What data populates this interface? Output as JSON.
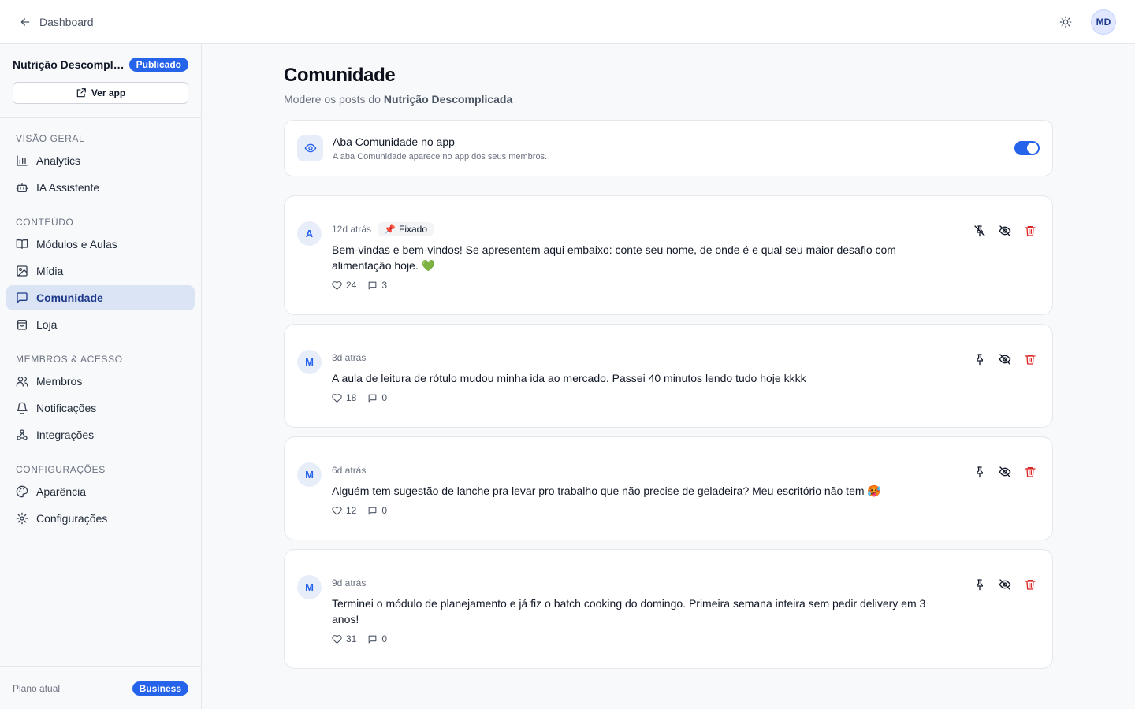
{
  "topbar": {
    "back_label": "Dashboard",
    "user_initials": "MD"
  },
  "sidebar": {
    "app_name": "Nutrição Descomplicada",
    "status_badge": "Publicado",
    "view_app_label": "Ver app",
    "sections": {
      "overview": "VISÃO GERAL",
      "content": "CONTEÚDO",
      "members": "MEMBROS & ACESSO",
      "settings": "CONFIGURAÇÕES"
    },
    "items": {
      "analytics": "Analytics",
      "assistant": "IA Assistente",
      "modules": "Módulos e Aulas",
      "media": "Mídia",
      "community": "Comunidade",
      "store": "Loja",
      "members": "Membros",
      "notifications": "Notificações",
      "integrations": "Integrações",
      "appearance": "Aparência",
      "settings": "Configurações"
    },
    "plan_label": "Plano atual",
    "plan_value": "Business"
  },
  "main": {
    "title": "Comunidade",
    "subtitle_prefix": "Modere os posts do ",
    "subtitle_app": "Nutrição Descomplicada",
    "toggle": {
      "title": "Aba Comunidade no app",
      "description": "A aba Comunidade aparece no app dos seus membros.",
      "enabled": true
    }
  },
  "posts": [
    {
      "initial": "A",
      "time": "12d atrás",
      "badge": "Fixado",
      "pinned": true,
      "text": "Bem-vindas e bem-vindos! Se apresentem aqui embaixo: conte seu nome, de onde é e qual seu maior desafio com alimentação hoje. 💚",
      "likes": "24",
      "comments": "3"
    },
    {
      "initial": "M",
      "time": "3d atrás",
      "badge": "",
      "pinned": false,
      "text": "A aula de leitura de rótulo mudou minha ida ao mercado. Passei 40 minutos lendo tudo hoje kkkk",
      "likes": "18",
      "comments": "0"
    },
    {
      "initial": "M",
      "time": "6d atrás",
      "badge": "",
      "pinned": false,
      "text": "Alguém tem sugestão de lanche pra levar pro trabalho que não precise de geladeira? Meu escritório não tem 🥵",
      "likes": "12",
      "comments": "0"
    },
    {
      "initial": "M",
      "time": "9d atrás",
      "badge": "",
      "pinned": false,
      "text": "Terminei o módulo de planejamento e já fiz o batch cooking do domingo. Primeira semana inteira sem pedir delivery em 3 anos!",
      "likes": "31",
      "comments": "0"
    }
  ],
  "colors": {
    "accent": "#2563eb",
    "danger": "#dc2626",
    "active_nav_bg": "#dbe4f5"
  }
}
